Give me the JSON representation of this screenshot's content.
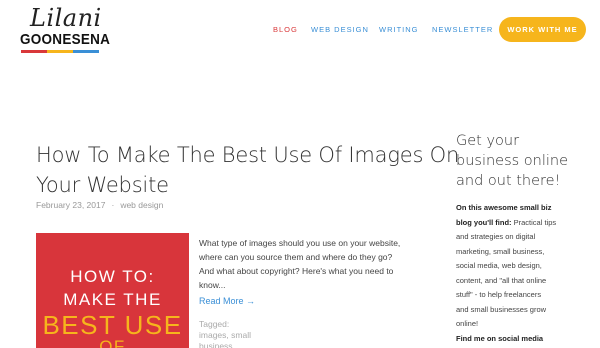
{
  "logo": {
    "script": "Lilani",
    "surname": "GOONESENA",
    "bar_colors": [
      "#d9383a",
      "#f6b51c",
      "#3a8fd6"
    ]
  },
  "nav": {
    "items": [
      {
        "label": "BLOG",
        "active": true
      },
      {
        "label": "WEB DESIGN",
        "active": false
      },
      {
        "label": "WRITING",
        "active": false
      },
      {
        "label": "NEWSLETTER",
        "active": false
      }
    ],
    "cta": "WORK WITH ME"
  },
  "colors": {
    "accent_red": "#d9383a",
    "accent_yellow": "#f6b51c",
    "link_blue": "#3a8fd6"
  },
  "post": {
    "title_lines": [
      "How To Make The Best Use Of Images On",
      "Your Website"
    ],
    "date": "February 23, 2017",
    "separator": "·",
    "category": "web design",
    "hero_lines": [
      "HOW TO:",
      "MAKE THE",
      "BEST USE",
      "OF"
    ],
    "excerpt_lines": [
      "What type of images should you use on your website,",
      "where can you source them and where do they go?",
      "And what about copyright? Here's what you need to",
      "know..."
    ],
    "read_more": "Read More →",
    "tags_label": "Tagged:",
    "tags": [
      "images",
      "small",
      "business"
    ]
  },
  "sidebar": {
    "title_lines": [
      "Get your",
      "business online",
      "and out there!"
    ],
    "intro_bold": "On this awesome small biz",
    "intro_bold_2": "blog you'll find:",
    "body_first": "Practical tips",
    "body_lines": [
      "and strategies on digital",
      "marketing, small business,",
      "social media, web design,",
      "content, and \"all that online",
      "stuff\" - to help freelancers",
      "and small businesses grow",
      "online!"
    ],
    "social_heading": "Find me on social media"
  }
}
